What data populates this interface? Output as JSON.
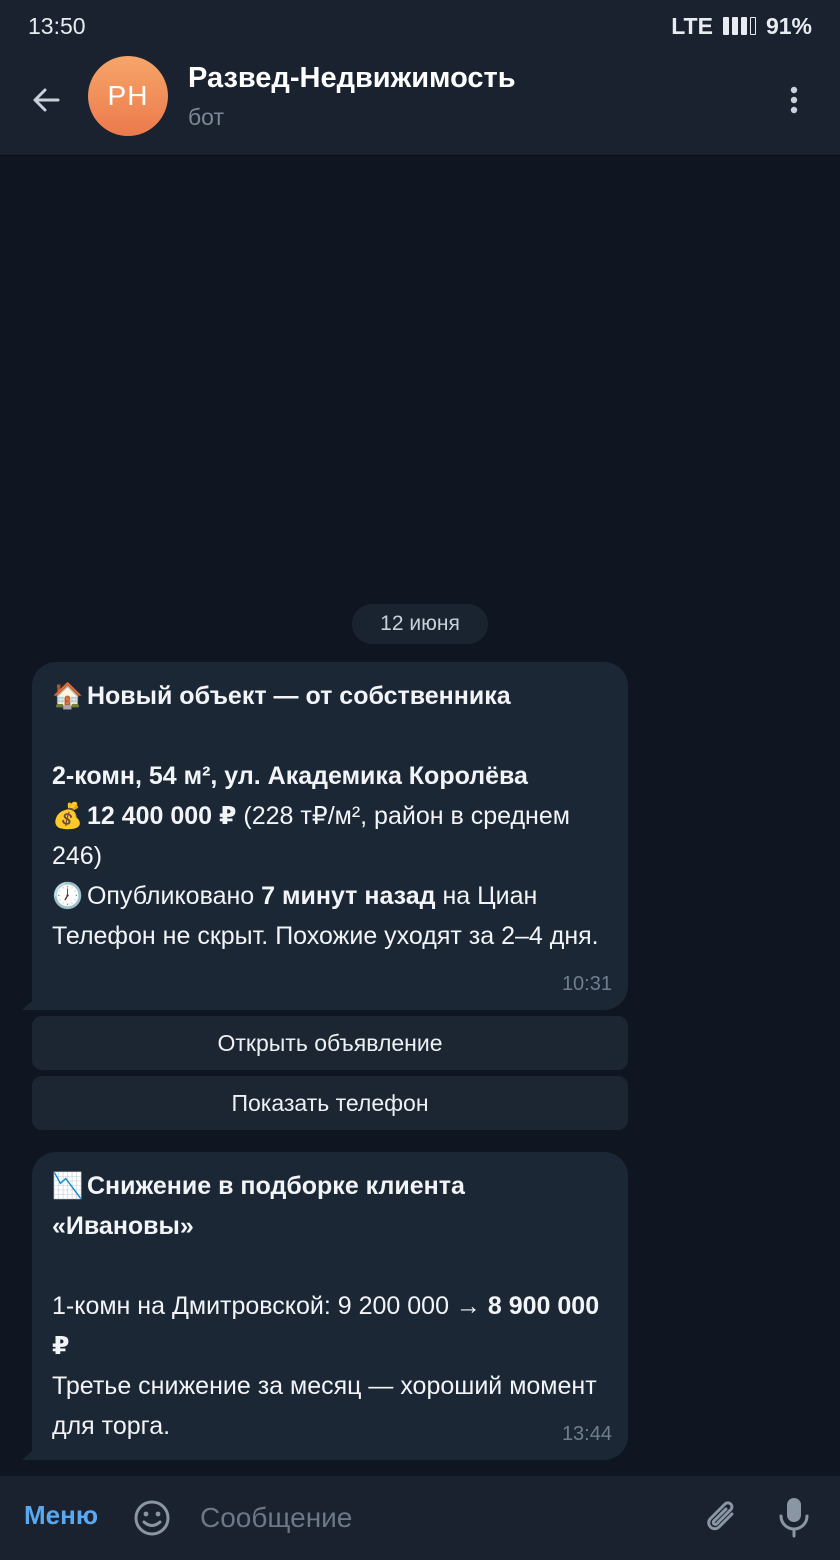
{
  "status_bar": {
    "time": "13:50",
    "network": "LTE",
    "battery": "91%",
    "signal_bars_filled": 3,
    "signal_bars_total": 4
  },
  "header": {
    "avatar_initials": "РН",
    "title": "Развед-Недвижимость",
    "subtitle": "бот"
  },
  "date_separator": "12 июня",
  "messages": [
    {
      "icon": "🏠",
      "title": "Новый объект — от собственника",
      "line1_bold": "2-комн, 54 м², ул. Академика Королёва",
      "price_icon": "💰",
      "price_bold": "12 400 000 ₽",
      "price_rest": " (228 т₽/м², район в среднем 246)",
      "clock_icon": "🕖",
      "published_prefix": "Опубликовано ",
      "published_bold": "7 минут назад",
      "published_suffix": " на Циан",
      "note": "Телефон не скрыт. Похожие уходят за 2–4 дня.",
      "time": "10:31"
    },
    {
      "icon": "📉",
      "title": "Снижение в подборке клиента «Ивановы»",
      "line_prefix": "1-комн на Дмитровской: 9 200 000 → ",
      "line_bold": "8 900 000 ₽",
      "note": "Третье снижение за месяц — хороший момент для торга.",
      "time": "13:44"
    }
  ],
  "inline_buttons": [
    {
      "label": "Открыть объявление"
    },
    {
      "label": "Показать телефон"
    }
  ],
  "input_bar": {
    "menu_label": "Меню",
    "placeholder": "Сообщение"
  },
  "colors": {
    "background": "#0f1621",
    "header": "#19222e",
    "bubble": "#1b2735",
    "accent": "#5aa8f0",
    "avatar_gradient_top": "#f6a56a",
    "avatar_gradient_bottom": "#ec7a4c"
  }
}
